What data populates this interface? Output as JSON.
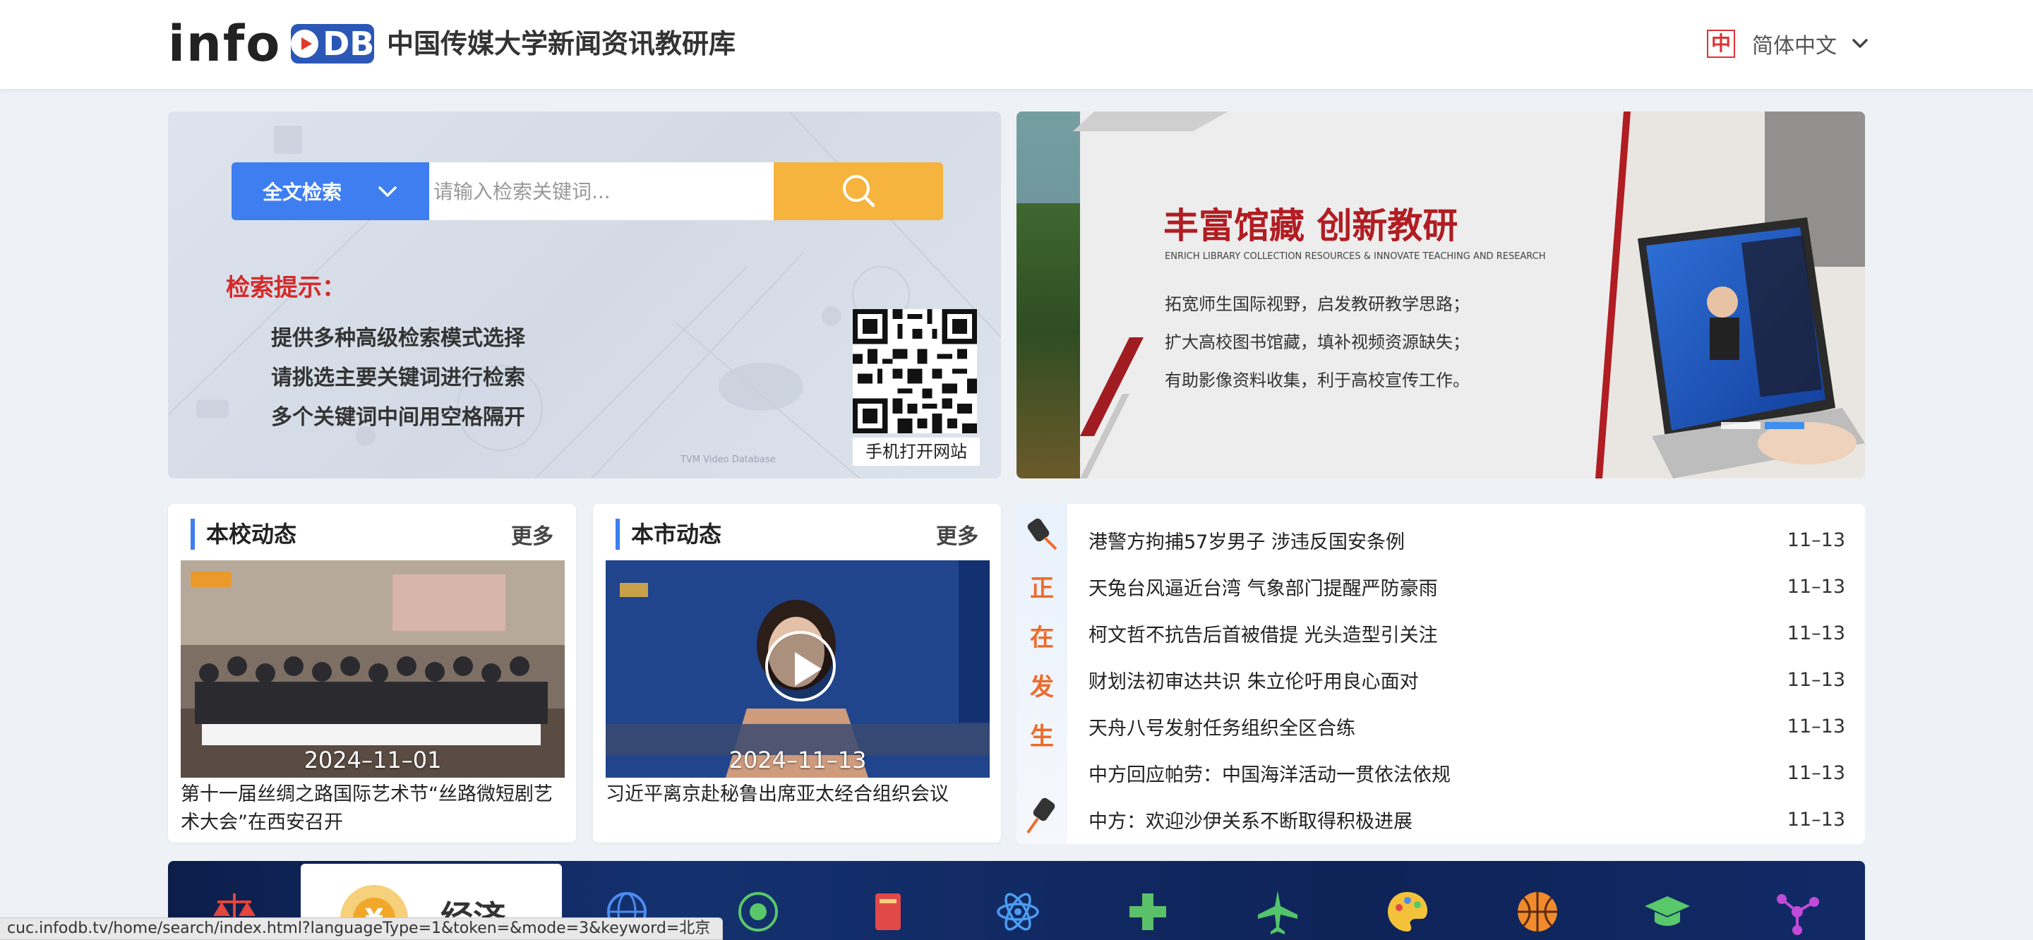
{
  "header": {
    "logo_text": "info",
    "logo_badge": "DB",
    "site_title": "中国传媒大学新闻资讯教研库",
    "lang_icon_char": "中",
    "lang_label": "简体中文"
  },
  "search": {
    "type_label": "全文检索",
    "placeholder": "请输入检索关键词...",
    "tips_title": "检索提示：",
    "tips": [
      "提供多种高级检索模式选择",
      "请挑选主要关键词进行检索",
      "多个关键词中间用空格隔开"
    ],
    "qr_caption": "手机打开网站",
    "watermark": "TVM Video Database"
  },
  "banner": {
    "title": "丰富馆藏 创新教研",
    "subtitle": "ENRICH LIBRARY COLLECTION RESOURCES & INNOVATE TEACHING AND RESEARCH",
    "lines": [
      "拓宽师生国际视野，启发教研教学思路；",
      "扩大高校图书馆藏，填补视频资源缺失；",
      "有助影像资料收集，利于高校宣传工作。"
    ]
  },
  "school_news": {
    "title": "本校动态",
    "more": "更多",
    "date": "2024–11–01",
    "caption": "第十一届丝绸之路国际艺术节“丝路微短剧艺术大会”在西安召开"
  },
  "city_news": {
    "title": "本市动态",
    "more": "更多",
    "date": "2024–11–13",
    "caption": "习近平离京赴秘鲁出席亚太经合组织会议"
  },
  "happening": {
    "side_chars": [
      "正",
      "在",
      "发",
      "生"
    ],
    "items": [
      {
        "title": "港警方拘捕57岁男子 涉违反国安条例",
        "date": "11–13"
      },
      {
        "title": "天兔台风逼近台湾 气象部门提醒严防豪雨",
        "date": "11–13"
      },
      {
        "title": "柯文哲不抗告后首被借提 光头造型引关注",
        "date": "11–13"
      },
      {
        "title": "财划法初审达共识 朱立伦吁用良心面对",
        "date": "11–13"
      },
      {
        "title": "天舟八号发射任务组织全区合练",
        "date": "11–13"
      },
      {
        "title": "中方回应帕劳：中国海洋活动一贯依法依规",
        "date": "11–13"
      },
      {
        "title": "中方：欢迎沙伊关系不断取得积极进展",
        "date": "11–13"
      }
    ]
  },
  "categories": {
    "active_label": "经济",
    "active_icon_char": "¥",
    "icons": [
      "scales-icon",
      "globe-icon",
      "orbit-icon",
      "book-icon",
      "atom-icon",
      "medical-cross-icon",
      "airplane-icon",
      "palette-icon",
      "basketball-icon",
      "graduation-cap-icon",
      "network-icon"
    ]
  },
  "status_bar": {
    "url": "cuc.infodb.tv/home/search/index.html?languageType=1&token=&mode=3&keyword=北京"
  },
  "colors": {
    "accent_blue": "#3e7ef0",
    "search_orange": "#f6b33e",
    "tip_red": "#d42a2a",
    "banner_red": "#b01d22",
    "happening_orange": "#ee6b2c"
  }
}
